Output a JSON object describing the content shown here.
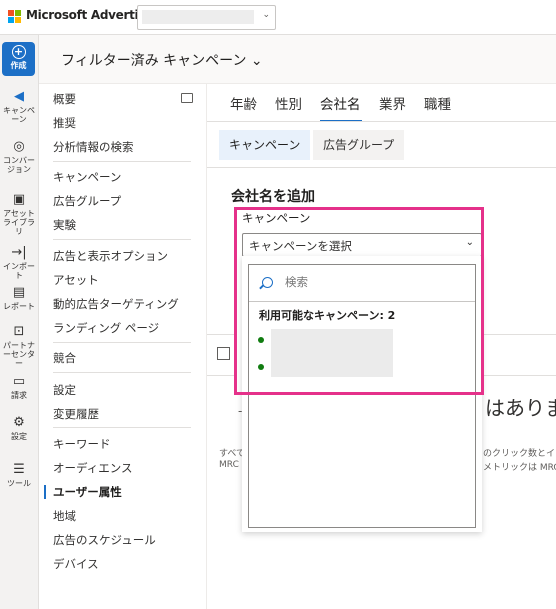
{
  "topbar": {
    "brand": "Microsoft Advertising",
    "logo_colors": [
      "#f25022",
      "#7fba00",
      "#00a4ef",
      "#ffb900"
    ]
  },
  "rail": {
    "create_label": "作成",
    "items": [
      {
        "icon": "megaphone-icon",
        "label": "キャンペーン"
      },
      {
        "icon": "target-icon",
        "label": "コンバージョン"
      },
      {
        "icon": "asset-library-icon",
        "label": "アセットライブラリ"
      },
      {
        "icon": "import-icon",
        "label": "インポート"
      },
      {
        "icon": "report-icon",
        "label": "レポート"
      },
      {
        "icon": "briefcase-icon",
        "label": "パートナーセンター"
      },
      {
        "icon": "wallet-icon",
        "label": "請求"
      },
      {
        "icon": "gear-icon",
        "label": "設定"
      },
      {
        "icon": "tools-icon",
        "label": "ツール"
      }
    ]
  },
  "header": {
    "title": "フィルター済み キャンペーン ⌄"
  },
  "leftnav": {
    "items": [
      "概要",
      "推奨",
      "分析情報の検索",
      "キャンペーン",
      "広告グループ",
      "実験",
      "広告と表示オプション",
      "アセット",
      "動的広告ターゲティング",
      "ランディング ページ",
      "競合",
      "設定",
      "変更履歴",
      "キーワード",
      "オーディエンス",
      "ユーザー属性",
      "地域",
      "広告のスケジュール",
      "デバイス"
    ],
    "active": "ユーザー属性"
  },
  "tabs": [
    "年齢",
    "性別",
    "会社名",
    "業界",
    "職種"
  ],
  "active_tab": "会社名",
  "segments": [
    "キャンペーン",
    "広告グループ"
  ],
  "panel": {
    "title": "会社名を追加",
    "campaign_label": "キャンペーン",
    "select_placeholder": "キャンペーンを選択",
    "search_placeholder": "検索",
    "available_label": "利用可能なキャンペーン: 2"
  },
  "background": {
    "empty_text": "はありま",
    "dash": "-",
    "footer_left_1": "すべて",
    "footer_left_2": "MRC",
    "footer_right_1": "のクリック数とイン",
    "footer_right_2": "メトリックは MRC"
  },
  "colors": {
    "accent": "#1c6fc6",
    "highlight": "#e5318a",
    "status_dot": "#107c10"
  }
}
